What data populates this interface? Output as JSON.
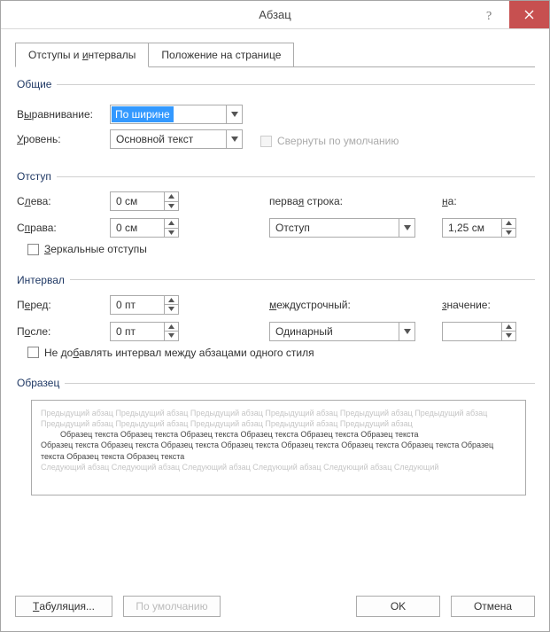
{
  "window": {
    "title": "Абзац"
  },
  "tabs": {
    "indents": "Отступы и интервалы",
    "position": "Положение на странице"
  },
  "general": {
    "legend": "Общие",
    "alignment_label": "Выравнивание:",
    "alignment_value": "По ширине",
    "level_label": "Уровень:",
    "level_value": "Основной текст",
    "collapsed_label": "Свернуты по умолчанию"
  },
  "indent": {
    "legend": "Отступ",
    "left_label": "Слева:",
    "left_value": "0 см",
    "right_label": "Справа:",
    "right_value": "0 см",
    "firstline_label": "первая строка:",
    "firstline_value": "Отступ",
    "by_label": "на:",
    "by_value": "1,25 см",
    "mirror_label": "Зеркальные отступы"
  },
  "spacing": {
    "legend": "Интервал",
    "before_label": "Перед:",
    "before_value": "0 пт",
    "after_label": "После:",
    "after_value": "0 пт",
    "line_label": "междустрочный:",
    "line_value": "Одинарный",
    "at_label": "значение:",
    "at_value": "",
    "noadd_label": "Не добавлять интервал между абзацами одного стиля"
  },
  "preview": {
    "legend": "Образец",
    "prev_para": "Предыдущий абзац Предыдущий абзац Предыдущий абзац Предыдущий абзац Предыдущий абзац Предыдущий абзац Предыдущий абзац Предыдущий абзац Предыдущий абзац Предыдущий абзац Предыдущий абзац",
    "sample1": "Образец текста Образец текста Образец текста Образец текста Образец текста Образец текста",
    "sample2": "Образец текста Образец текста Образец текста Образец текста Образец текста Образец текста Образец текста Образец текста Образец текста Образец текста",
    "next_para": "Следующий абзац Следующий абзац Следующий абзац Следующий абзац Следующий абзац Следующий"
  },
  "buttons": {
    "tabs": "Табуляция...",
    "default": "По умолчанию",
    "ok": "OK",
    "cancel": "Отмена"
  }
}
